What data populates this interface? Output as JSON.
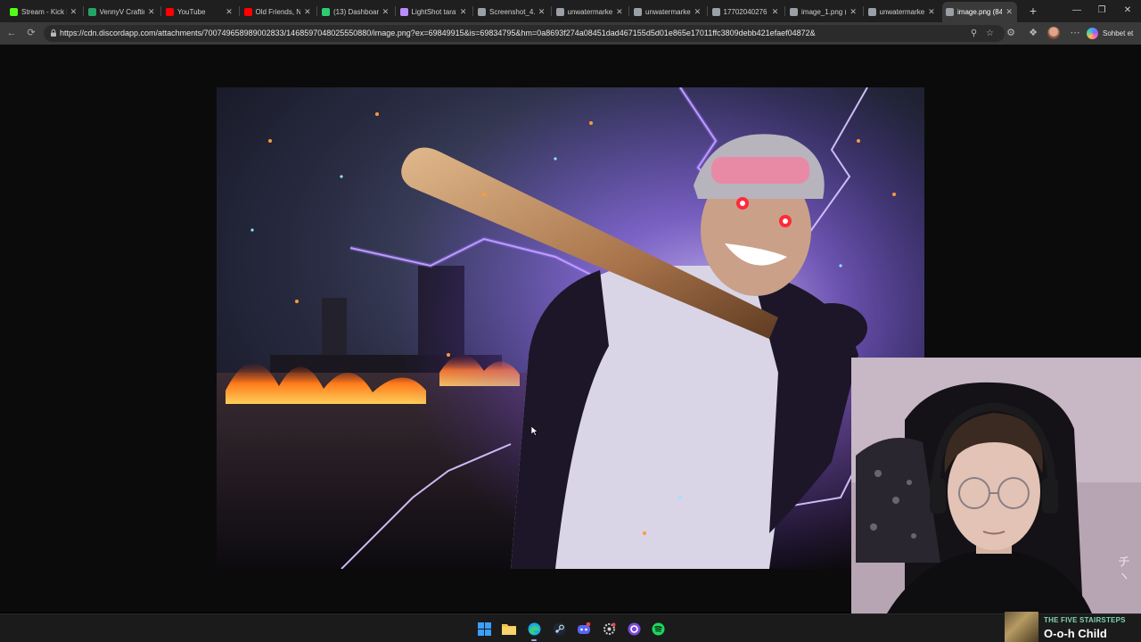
{
  "browser": {
    "tabs": [
      {
        "label": "Stream - Kick D",
        "icon": "kick-icon",
        "color": "#53fc18"
      },
      {
        "label": "VennyV Craftin",
        "icon": "sheets-icon",
        "color": "#23a566"
      },
      {
        "label": "YouTube",
        "icon": "youtube-icon",
        "color": "#ff0000"
      },
      {
        "label": "Old Friends, Ne",
        "icon": "youtube-icon",
        "color": "#ff0000"
      },
      {
        "label": "(13) Dashboard",
        "icon": "dashboard-icon",
        "color": "#2ecc71"
      },
      {
        "label": "LightShot taraf",
        "icon": "feather-icon",
        "color": "#b98cff"
      },
      {
        "label": "Screenshot_4.p",
        "icon": "globe-icon",
        "color": "#9aa0a6"
      },
      {
        "label": "unwatermarked",
        "icon": "globe-icon",
        "color": "#9aa0a6"
      },
      {
        "label": "unwatermarked",
        "icon": "globe-icon",
        "color": "#9aa0a6"
      },
      {
        "label": "17702040276",
        "icon": "globe-icon",
        "color": "#9aa0a6"
      },
      {
        "label": "image_1.png (",
        "icon": "globe-icon",
        "color": "#9aa0a6"
      },
      {
        "label": "unwatermarked",
        "icon": "globe-icon",
        "color": "#9aa0a6"
      },
      {
        "label": "image.png (84",
        "icon": "globe-icon",
        "color": "#9aa0a6",
        "active": true
      }
    ],
    "url": "https://cdn.discordapp.com/attachments/700749658989002833/1468597048025550880/image.png?ex=69849915&is=69834795&hm=0a8693f274a08451dad467155d5d01e865e17011ffc3809debb421efaef04872&",
    "copilot_label": "Sohbet et"
  },
  "stream_overlay": {
    "side_glyphs": "チ\nヽ"
  },
  "taskbar": {
    "apps": [
      "windows-start-icon",
      "file-explorer-icon",
      "edge-browser-icon",
      "steam-icon",
      "discord-icon",
      "settings-app-icon",
      "obs-icon",
      "spotify-icon"
    ]
  },
  "now_playing": {
    "artist": "THE FIVE STAIRSTEPS",
    "title": "O-o-h Child"
  },
  "colors": {
    "lightning": "#b58cff",
    "eyes": "#ff2a3a",
    "fire": "#ff7a1a",
    "np_artist": "#7fd6b0"
  }
}
